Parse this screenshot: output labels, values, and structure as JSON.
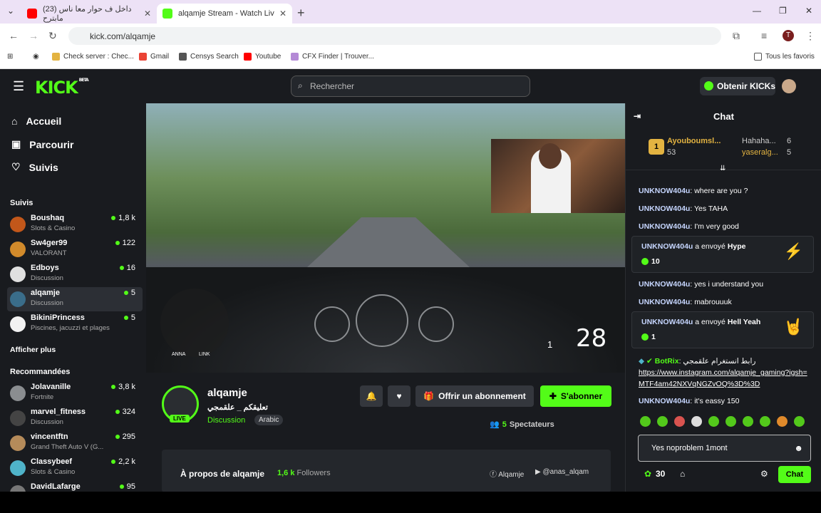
{
  "browser": {
    "tabs": [
      {
        "label": "(23) داخل ف حوار معا ناس مابترح",
        "active": false
      },
      {
        "label": "alqamje Stream - Watch Liv",
        "active": true
      }
    ],
    "url": "kick.com/alqamje",
    "bookmarks": [
      "Check server : Chec...",
      "Gmail",
      "Censys Search",
      "Youtube",
      "CFX Finder | Trouver..."
    ],
    "all_bookmarks": "Tous les favoris"
  },
  "header": {
    "logo": "KICK",
    "beta": "BETA",
    "search_placeholder": "Rechercher",
    "get_kicks": "Obtenir KICKs"
  },
  "sidebar": {
    "nav": [
      "Accueil",
      "Parcourir",
      "Suivis"
    ],
    "followed_title": "Suivis",
    "followed": [
      {
        "name": "Boushaq",
        "category": "Slots & Casino",
        "viewers": "1,8 k",
        "color": "#c2571a"
      },
      {
        "name": "Sw4ger99",
        "category": "VALORANT",
        "viewers": "122",
        "color": "#d18a2b"
      },
      {
        "name": "Edboys",
        "category": "Discussion",
        "viewers": "16",
        "color": "#e0e0e0"
      },
      {
        "name": "alqamje",
        "category": "Discussion",
        "viewers": "5",
        "color": "#3a6d8a"
      },
      {
        "name": "BikiniPrincess",
        "category": "Piscines, jacuzzi et plages",
        "viewers": "5",
        "color": "#f2f2f2"
      }
    ],
    "show_more": "Afficher plus",
    "recommended_title": "Recommandées",
    "recommended": [
      {
        "name": "Jolavanille",
        "category": "Fortnite",
        "viewers": "3,8 k",
        "color": "#8a8d90"
      },
      {
        "name": "marvel_fitness",
        "category": "Discussion",
        "viewers": "324",
        "color": "#444"
      },
      {
        "name": "vincentftn",
        "category": "Grand Theft Auto V (G...",
        "viewers": "295",
        "color": "#b58b5a"
      },
      {
        "name": "Classybeef",
        "category": "Slots & Casino",
        "viewers": "2,2 k",
        "color": "#4fb3c9"
      },
      {
        "name": "DavidLafarge",
        "category": "",
        "viewers": "95",
        "color": "#777"
      }
    ]
  },
  "stream": {
    "hud_speed": "28",
    "hud_gear": "1",
    "hud_labels": [
      "ANNA",
      "LINK"
    ],
    "channel_name": "alqamje",
    "title": "تعليقكم _ علقمجي",
    "category": "Discussion",
    "language": "Arabic",
    "live_badge": "LIVE",
    "subscribe_offer": "Offrir un abonnement",
    "follow": "S'abonner",
    "viewers": "5",
    "viewers_label": "Spectateurs",
    "about_title": "À propos de alqamje",
    "followers_count": "1,6 k",
    "followers_label": "Followers",
    "facebook": "Alqamje",
    "youtube": "@anas_alqam"
  },
  "chat": {
    "title": "Chat",
    "top_gifter": {
      "rank": "1",
      "name": "Ayouboumsl...",
      "count": "53"
    },
    "gifters": [
      {
        "name": "Hahaha...",
        "count": "6"
      },
      {
        "name": "yaseralg...",
        "count": "5"
      }
    ],
    "messages": [
      {
        "user": "UNKNOW404u",
        "text": "where are you ?"
      },
      {
        "user": "UNKNOW404u",
        "text": "Yes TAHA"
      },
      {
        "user": "UNKNOW404u",
        "text": "I'm very good"
      }
    ],
    "gift1": {
      "user": "UNKNOW404u",
      "verb": "a envoyé",
      "item": "Hype",
      "count": "10"
    },
    "messages2": [
      {
        "user": "UNKNOW404u",
        "text": "yes i understand you"
      },
      {
        "user": "UNKNOW404u",
        "text": "mabrouuuk"
      }
    ],
    "gift2": {
      "user": "UNKNOW404u",
      "verb": "a envoyé",
      "item": "Hell Yeah",
      "count": "1"
    },
    "bot": {
      "user": "BotRix",
      "text": "رابط انستغرام علقمجي",
      "link": "https://www.instagram.com/alqamje_gaming?igsh=MTF4am42NXVqNGZvOQ%3D%3D"
    },
    "last": {
      "user": "UNKNOW404u",
      "text": "it's eassy 150"
    },
    "input_value": "Yes noproblem 1mont",
    "points": "30",
    "send": "Chat"
  }
}
